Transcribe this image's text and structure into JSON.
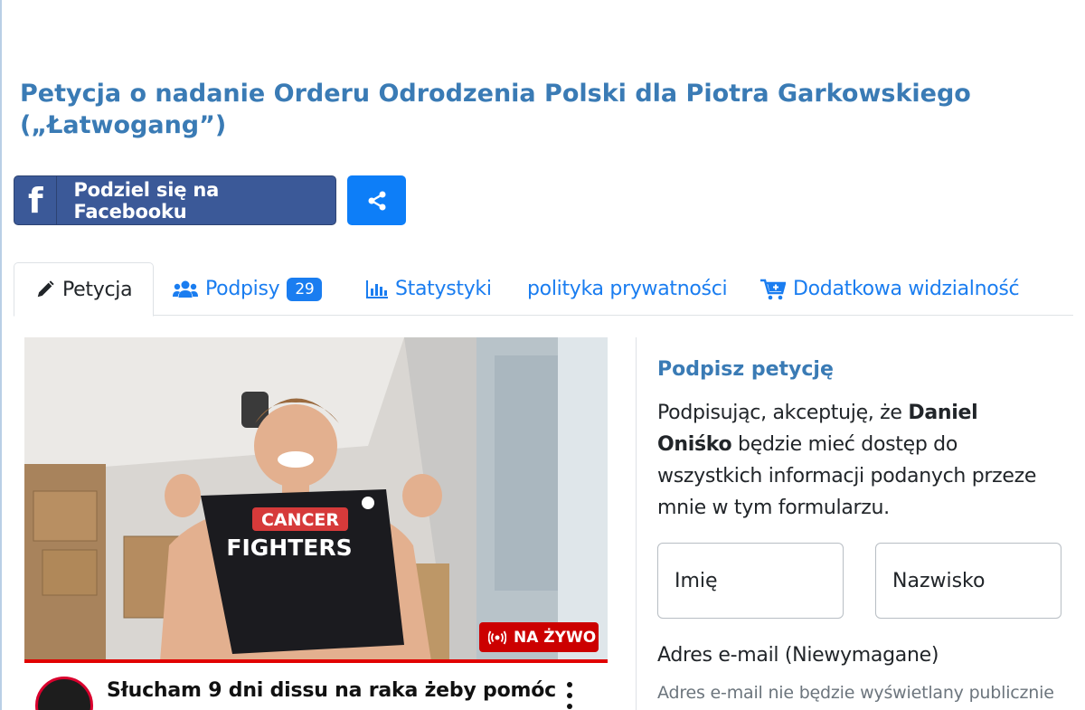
{
  "petition": {
    "title": "Petycja o nadanie Orderu Odrodzenia Polski dla Piotra Garkowskiego („Łatwogang”)"
  },
  "share": {
    "facebook_label": "Podziel się na Facebooku",
    "facebook_icon": "facebook-icon",
    "share_icon": "share-icon"
  },
  "tabs": [
    {
      "label": "Petycja",
      "icon": "pencil-icon",
      "active": true
    },
    {
      "label": "Podpisy",
      "icon": "users-icon",
      "badge": "29"
    },
    {
      "label": "Statystyki",
      "icon": "bar-chart-icon"
    },
    {
      "label": "polityka prywatności"
    },
    {
      "label": "Dodatkowa widzialność",
      "icon": "cart-plus-icon"
    }
  ],
  "video": {
    "shirt_line1": "CANCER",
    "shirt_line2": "FIGHTERS",
    "live_label": "NA ŻYWO",
    "title": "Słucham 9 dni dissu na raka żeby pomóc"
  },
  "sign_form": {
    "heading": "Podpisz petycję",
    "consent_prefix": "Podpisując, akceptuję, że ",
    "organizer": "Daniel Oniśko",
    "consent_suffix": " będzie mieć dostęp do wszystkich informacji podanych przeze mnie w tym formularzu.",
    "first_name_placeholder": "Imię",
    "last_name_placeholder": "Nazwisko",
    "email_label": "Adres e-mail (Niewymagane)",
    "email_help": "Adres e-mail nie będzie wyświetlany publicznie"
  },
  "colors": {
    "title": "#3a7bb5",
    "facebook": "#3b5998",
    "share": "#0d7ef8",
    "tab_link": "#1a7df0",
    "live": "#cc0000"
  }
}
